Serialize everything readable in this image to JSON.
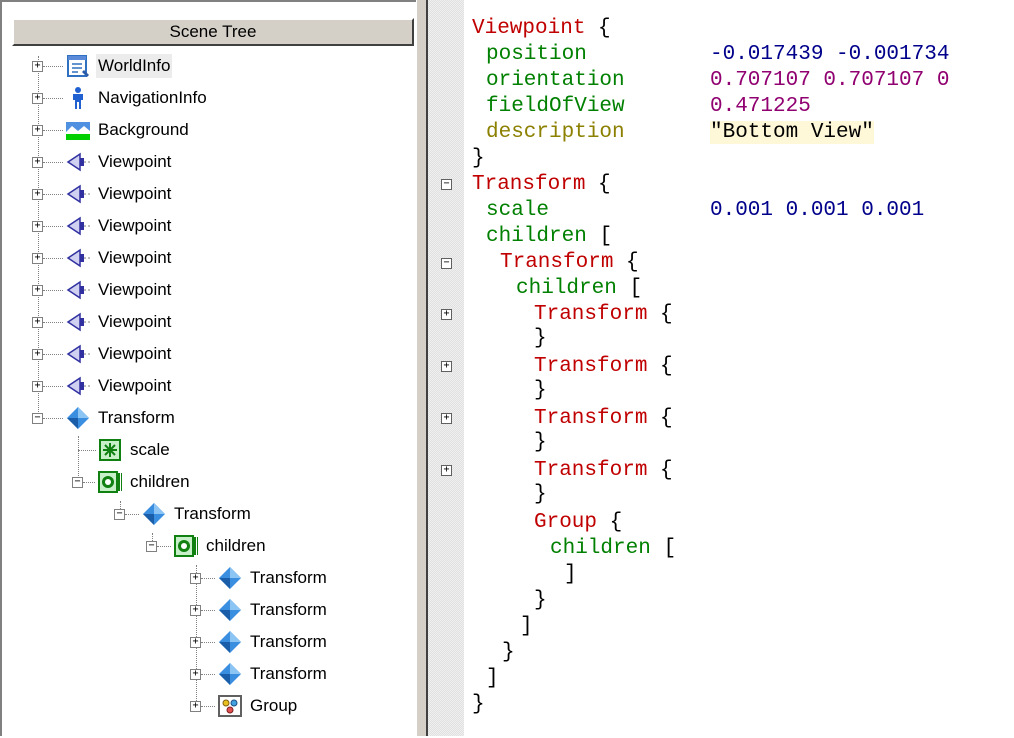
{
  "tree": {
    "header": "Scene Tree",
    "nodes": [
      {
        "label": "WorldInfo",
        "icon": "worldinfo-icon"
      },
      {
        "label": "NavigationInfo",
        "icon": "navigationinfo-icon"
      },
      {
        "label": "Background",
        "icon": "background-icon"
      },
      {
        "label": "Viewpoint",
        "icon": "viewpoint-icon"
      },
      {
        "label": "Viewpoint",
        "icon": "viewpoint-icon"
      },
      {
        "label": "Viewpoint",
        "icon": "viewpoint-icon"
      },
      {
        "label": "Viewpoint",
        "icon": "viewpoint-icon"
      },
      {
        "label": "Viewpoint",
        "icon": "viewpoint-icon"
      },
      {
        "label": "Viewpoint",
        "icon": "viewpoint-icon"
      },
      {
        "label": "Viewpoint",
        "icon": "viewpoint-icon"
      },
      {
        "label": "Viewpoint",
        "icon": "viewpoint-icon"
      },
      {
        "label": "Transform",
        "icon": "transform-icon"
      },
      {
        "label": "scale",
        "icon": "field-sf-icon"
      },
      {
        "label": "children",
        "icon": "field-mf-icon"
      },
      {
        "label": "Transform",
        "icon": "transform-icon"
      },
      {
        "label": "children",
        "icon": "field-mf-icon"
      },
      {
        "label": "Transform",
        "icon": "transform-icon"
      },
      {
        "label": "Transform",
        "icon": "transform-icon"
      },
      {
        "label": "Transform",
        "icon": "transform-icon"
      },
      {
        "label": "Transform",
        "icon": "transform-icon"
      },
      {
        "label": "Group",
        "icon": "group-icon"
      }
    ]
  },
  "code": {
    "viewpoint_kw": "Viewpoint",
    "open_brace": "{",
    "close_brace": "}",
    "open_bracket": "[",
    "close_bracket": "]",
    "position_field": "position",
    "position_value": "-0.017439 -0.001734",
    "orientation_field": "orientation",
    "orientation_value": "0.707107 0.707107 0",
    "fov_field": "fieldOfView",
    "fov_value": "0.471225",
    "description_field": "description",
    "description_value": "\"Bottom View\"",
    "transform_kw": "Transform",
    "scale_field": "scale",
    "scale_value": "0.001 0.001 0.001",
    "children_field": "children",
    "group_kw": "Group",
    "fold_collapse": "−",
    "fold_expand": "+"
  },
  "colors": {
    "keyword": "#c00000",
    "field": "#008000",
    "number": "#00008b",
    "rotation": "#900070",
    "description_field": "#8b8000"
  }
}
